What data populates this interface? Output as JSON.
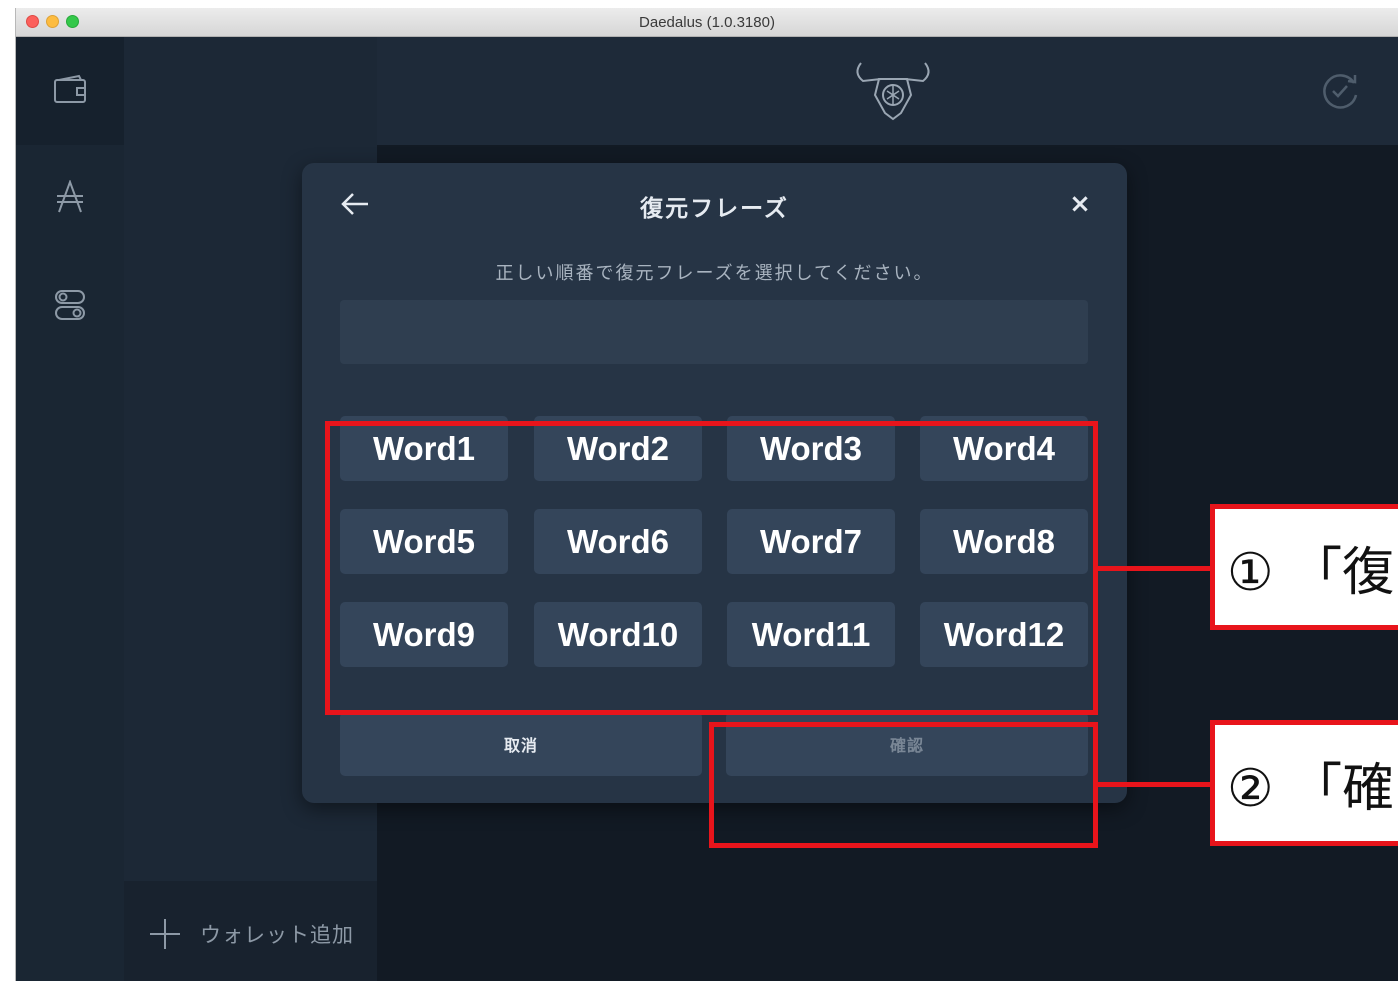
{
  "window": {
    "title": "Daedalus (1.0.3180)"
  },
  "sidebar": {
    "rail_icons": [
      "wallet-icon",
      "ada-icon",
      "settings-toggle-icon"
    ],
    "add_wallet_label": "ウォレット追加"
  },
  "topbar": {
    "logo": "daedalus-logo",
    "sync_icon": "sync-check-icon"
  },
  "dialog": {
    "title": "復元フレーズ",
    "instructions": "正しい順番で復元フレーズを選択してください。",
    "selected_phrase": "",
    "words": [
      "Word1",
      "Word2",
      "Word3",
      "Word4",
      "Word5",
      "Word6",
      "Word7",
      "Word8",
      "Word9",
      "Word10",
      "Word11",
      "Word12"
    ],
    "cancel_label": "取消",
    "confirm_label": "確認"
  },
  "annotations": {
    "callout1": "① 「復",
    "callout2": "② 「確",
    "color": "#e8141b"
  },
  "colors": {
    "app_background": "#1c2836",
    "dialog_background": "#263445",
    "word_button": "#34455a",
    "highlight": "#e8141b"
  }
}
